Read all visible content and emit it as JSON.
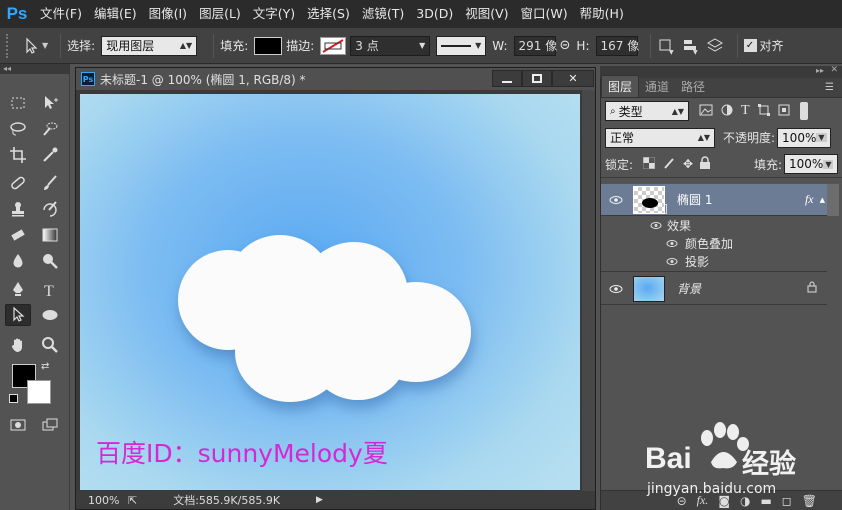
{
  "menubar": {
    "logo": "Ps",
    "items": [
      "文件(F)",
      "编辑(E)",
      "图像(I)",
      "图层(L)",
      "文字(Y)",
      "选择(S)",
      "滤镜(T)",
      "3D(D)",
      "视图(V)",
      "窗口(W)",
      "帮助(H)"
    ]
  },
  "options": {
    "select_label": "选择:",
    "select_value": "现用图层",
    "fill_label": "填充:",
    "stroke_label": "描边:",
    "stroke_size": "3 点",
    "w_label": "W:",
    "w_value": "291 像",
    "h_label": "H:",
    "h_value": "167 像",
    "align_label": "对齐"
  },
  "document": {
    "title": "未标题-1 @ 100% (椭圆 1, RGB/8) *",
    "canvas_text": "百度ID：sunnyMelody夏",
    "zoom": "100%",
    "doc_info": "文档:585.9K/585.9K"
  },
  "layers_panel": {
    "tabs": [
      "图层",
      "通道",
      "路径"
    ],
    "kind_filter": "类型",
    "blend_mode": "正常",
    "opacity_label": "不透明度:",
    "opacity_value": "100%",
    "lock_label": "锁定:",
    "fill_label": "填充:",
    "fill_value": "100%",
    "layers": [
      {
        "name": "椭圆 1",
        "fx": "fx",
        "effects_label": "效果",
        "effects": [
          "颜色叠加",
          "投影"
        ]
      },
      {
        "name": "背景"
      }
    ]
  },
  "watermark": {
    "brand_left": "Bai",
    "brand_right": "经验",
    "url": "jingyan.baidu.com"
  },
  "colors": {
    "ps_blue": "#31a8ff",
    "canvas_center": "#5aa9f2",
    "canvas_edge": "#b5def0",
    "watermark_magenta": "#d428d4",
    "selected_layer": "#6d7c95"
  }
}
